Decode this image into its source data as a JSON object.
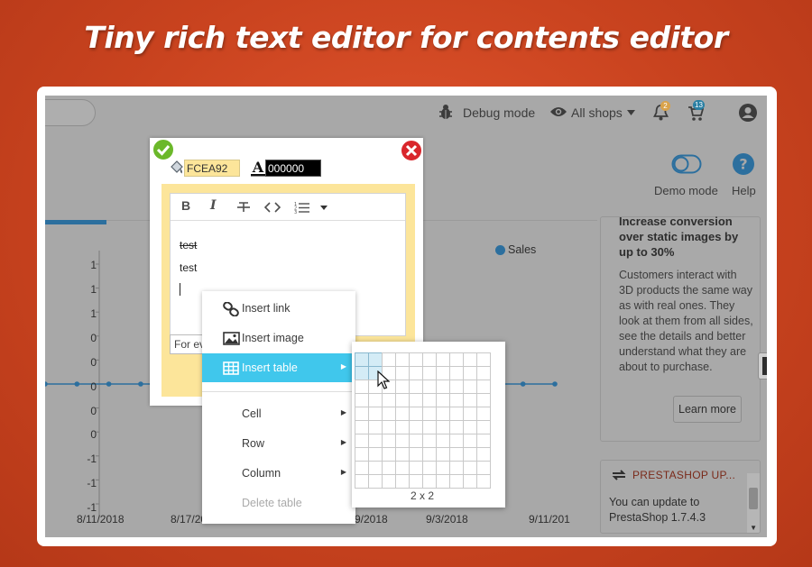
{
  "banner": {
    "title": "Tiny rich text editor for contents editor"
  },
  "topbar": {
    "debug_label": "Debug mode",
    "shops_label": "All shops",
    "notif_count": "2",
    "orders_count": "13",
    "demo_label": "Demo mode",
    "help_label": "Help"
  },
  "right_panel": {
    "headline": "Increase conversion over static images by up to 30%",
    "body": "Customers interact with 3D products the same way as with real ones. They look at them from all sides, see the details and better understand what they are about to purchase.",
    "learn_more": "Learn more"
  },
  "update_panel": {
    "title": "PRESTASHOP UP...",
    "text": "You can update to PrestaShop 1.7.4.3"
  },
  "chart_data": {
    "type": "line",
    "legend": "Sales",
    "y_tick_labels": [
      "1",
      "1",
      "1",
      "0",
      "0",
      "0",
      "0",
      "0",
      "-1",
      "-1",
      "-1"
    ],
    "x_tick_labels": [
      "8/11/2018",
      "8/17/201",
      "9/2018",
      "9/3/2018",
      "9/11/201"
    ],
    "series": [
      {
        "name": "Sales",
        "values": [
          0,
          0,
          0,
          0,
          0,
          0,
          0,
          0,
          0,
          0,
          0,
          0,
          0,
          0,
          0,
          0,
          0
        ]
      }
    ],
    "ylim": [
      -1,
      1
    ],
    "grid": false,
    "legend_position": "top-right"
  },
  "editor": {
    "bg_color_value": "FCEA92",
    "text_color_value": "000000",
    "line1": "test",
    "line2": "test",
    "for_placeholder": "For eve"
  },
  "colors": {
    "accent": "#40c7ec",
    "banner": "#d04a24",
    "highlight": "#fce59a",
    "series": "#2c6f9e"
  },
  "context_menu": {
    "items": [
      {
        "label": "Insert link",
        "icon": "link-icon"
      },
      {
        "label": "Insert image",
        "icon": "image-icon"
      },
      {
        "label": "Insert table",
        "icon": "table-icon"
      },
      {
        "label": "Cell"
      },
      {
        "label": "Row"
      },
      {
        "label": "Column"
      },
      {
        "label": "Delete table"
      }
    ]
  },
  "table_grid": {
    "cols": 10,
    "rows": 10,
    "selected_cols": 2,
    "selected_rows": 2,
    "caption": "2 x 2"
  }
}
